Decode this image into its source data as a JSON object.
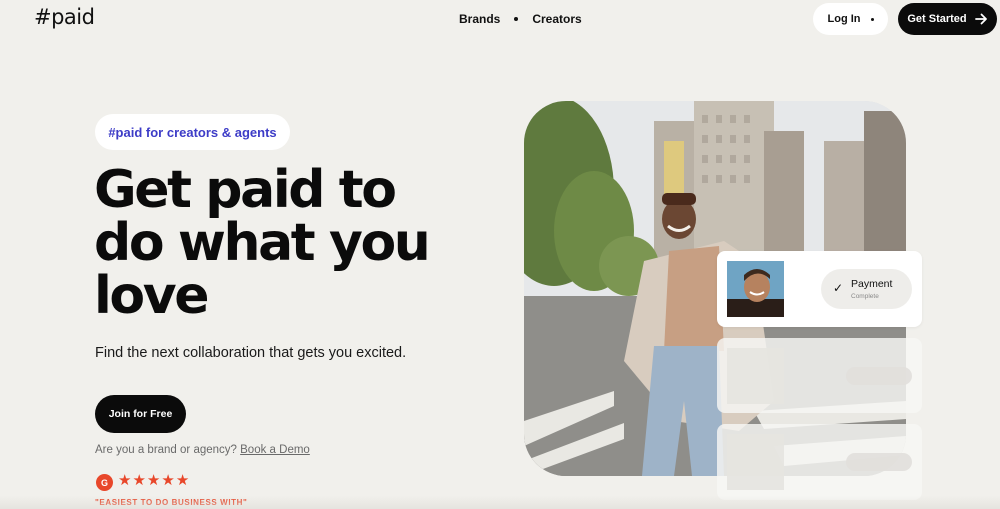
{
  "nav": {
    "logo": "#paid",
    "links": [
      "Brands",
      "Creators"
    ],
    "login_label": "Log In",
    "cta_label": "Get Started"
  },
  "hero": {
    "pill": "#paid for creators & agents",
    "headline": [
      "Get paid to",
      "do what you",
      "love"
    ],
    "subtext": "Find the next collaboration that gets you excited.",
    "join_label": "Join for Free",
    "brand_prompt": "Are you a brand or agency?",
    "brand_link": "Book a Demo",
    "rating_badge": "G",
    "rating_stars": 5,
    "rating_quote": "\"EASIEST TO DO BUSINESS WITH\""
  },
  "payment_card": {
    "title": "Payment",
    "status": "Complete"
  },
  "colors": {
    "accent_purple": "#3d3cc7",
    "rating_red": "#e8472a",
    "button_dark": "#0b0b0b",
    "page_bg": "#f1f0ec"
  },
  "icons": [
    "arrow-right-icon",
    "check-icon",
    "star-icon",
    "g2-logo-icon"
  ]
}
